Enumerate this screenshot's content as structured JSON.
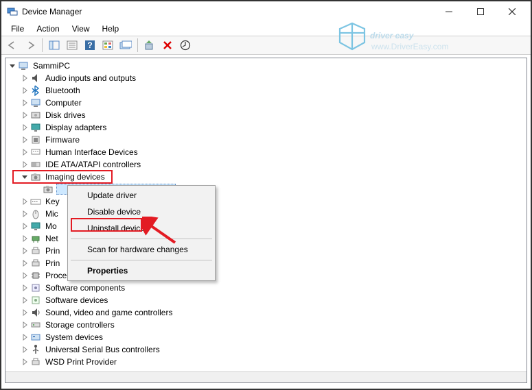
{
  "window": {
    "title": "Device Manager",
    "controls": {
      "min": "—",
      "max": "▢",
      "close": "✕"
    }
  },
  "menu": {
    "items": [
      "File",
      "Action",
      "View",
      "Help"
    ]
  },
  "toolbar_icons": [
    "back",
    "forward",
    "|",
    "show-all",
    "properties",
    "help",
    "devices-by",
    "show-hidden",
    "|",
    "scan",
    "uninstall",
    "update"
  ],
  "root": {
    "name": "SammiPC"
  },
  "categories": [
    {
      "label": "Audio inputs and outputs",
      "icon": "audio"
    },
    {
      "label": "Bluetooth",
      "icon": "bluetooth"
    },
    {
      "label": "Computer",
      "icon": "computer"
    },
    {
      "label": "Disk drives",
      "icon": "disk"
    },
    {
      "label": "Display adapters",
      "icon": "display"
    },
    {
      "label": "Firmware",
      "icon": "firmware"
    },
    {
      "label": "Human Interface Devices",
      "icon": "hid"
    },
    {
      "label": "IDE ATA/ATAPI controllers",
      "icon": "ide"
    },
    {
      "label": "Imaging devices",
      "icon": "imaging",
      "expanded": true
    },
    {
      "label": "Key",
      "icon": "keyboard",
      "truncated": true
    },
    {
      "label": "Mic",
      "icon": "mouse",
      "truncated": true
    },
    {
      "label": "Mo",
      "icon": "monitor",
      "truncated": true
    },
    {
      "label": "Net",
      "icon": "network",
      "truncated": true
    },
    {
      "label": "Prin",
      "icon": "printqueue",
      "truncated": true
    },
    {
      "label": "Prin",
      "icon": "printer",
      "truncated": true
    },
    {
      "label": "Processors",
      "icon": "cpu"
    },
    {
      "label": "Software components",
      "icon": "swc"
    },
    {
      "label": "Software devices",
      "icon": "swd"
    },
    {
      "label": "Sound, video and game controllers",
      "icon": "sound"
    },
    {
      "label": "Storage controllers",
      "icon": "storage"
    },
    {
      "label": "System devices",
      "icon": "system"
    },
    {
      "label": "Universal Serial Bus controllers",
      "icon": "usb"
    },
    {
      "label": "WSD Print Provider",
      "icon": "wsd"
    }
  ],
  "context_menu": {
    "items": [
      {
        "label": "Update driver"
      },
      {
        "label": "Disable device"
      },
      {
        "label": "Uninstall device",
        "highlight": true
      },
      {
        "sep": true
      },
      {
        "label": "Scan for hardware changes"
      },
      {
        "sep": true
      },
      {
        "label": "Properties",
        "bold": true
      }
    ]
  },
  "watermark": {
    "brand": "driver easy",
    "url": "www.DriverEasy.com"
  },
  "highlight_colors": {
    "box": "#e31b23",
    "arrow": "#e31b23"
  }
}
